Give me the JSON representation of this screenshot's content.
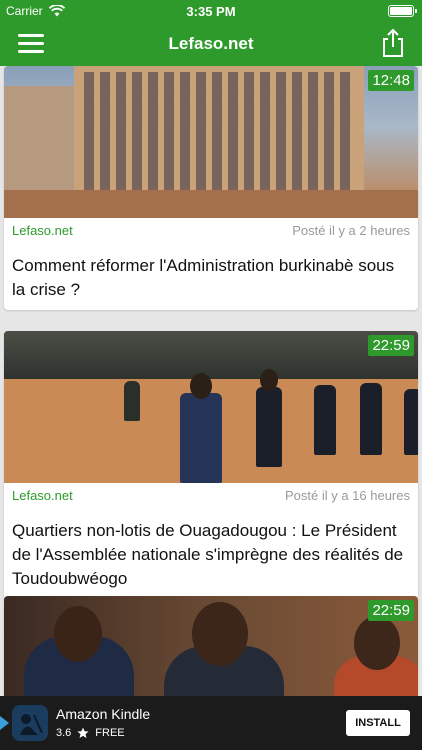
{
  "status_bar": {
    "carrier": "Carrier",
    "time": "3:35 PM"
  },
  "nav": {
    "title": "Lefaso.net"
  },
  "colors": {
    "brand_green": "#2e9a2b",
    "background": "#e6e6e6",
    "muted": "#9a9a9a"
  },
  "articles": [
    {
      "duration": "12:48",
      "source": "Lefaso.net",
      "posted": "Posté il y a 2 heures",
      "headline": "Comment réformer l'Administration burkinabè sous la crise ?"
    },
    {
      "duration": "22:59",
      "source": "Lefaso.net",
      "posted": "Posté il y a 16 heures",
      "headline": "Quartiers non-lotis de Ouagadougou : Le Président de l'Assemblée nationale s'imprègne des réalités de Toudoubwéogo"
    },
    {
      "duration": "22:59"
    }
  ],
  "ad": {
    "app_name": "Amazon Kindle",
    "rating": "3.6",
    "price": "FREE",
    "install_label": "INSTALL"
  }
}
